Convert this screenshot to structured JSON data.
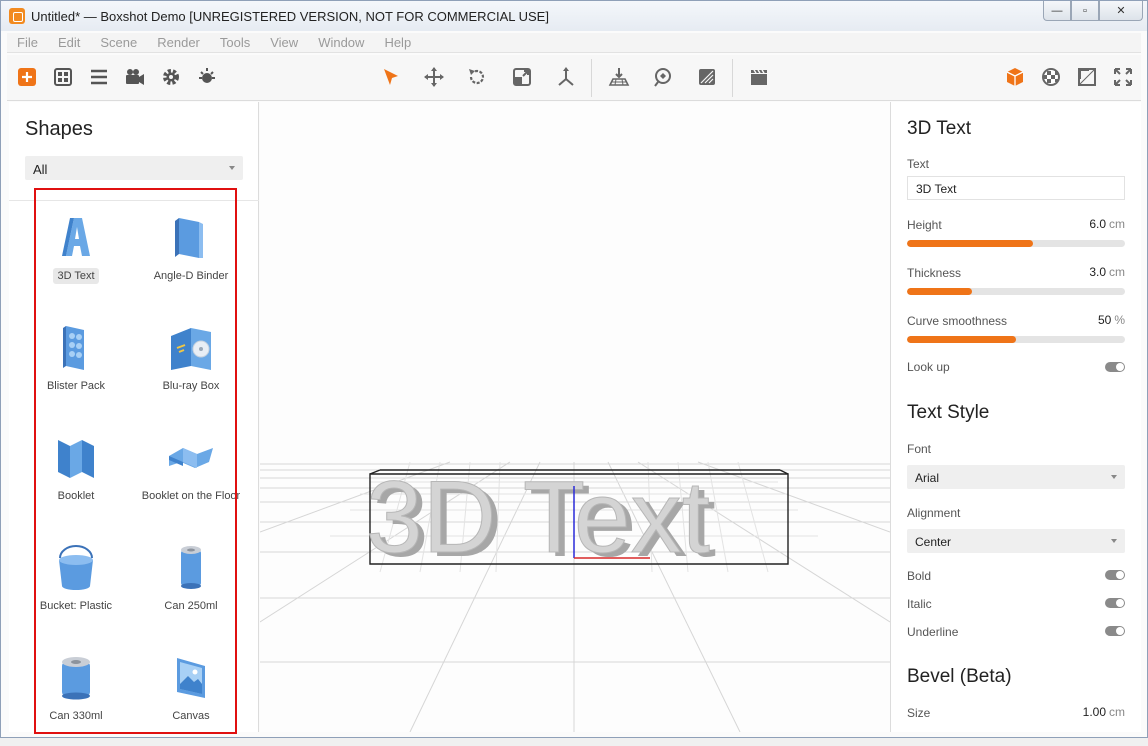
{
  "window": {
    "title": "Untitled* — Boxshot Demo [UNREGISTERED VERSION, NOT FOR COMMERCIAL USE]",
    "minimize_glyph": "—",
    "maximize_glyph": "▫",
    "close_glyph": "✕"
  },
  "menu": [
    "File",
    "Edit",
    "Scene",
    "Render",
    "Tools",
    "View",
    "Window",
    "Help"
  ],
  "toolbar": {
    "left_icons": [
      "add-icon",
      "grid-icon",
      "list-icon",
      "camera-icon",
      "gear-icon",
      "light-icon"
    ],
    "center_icons": [
      "select-arrow-icon",
      "move-icon",
      "rotate-icon",
      "scale-icon",
      "axis-icon"
    ],
    "center2_icons": [
      "floor-icon",
      "view-icon",
      "material-icon"
    ],
    "render_icon": "clapper-icon",
    "right_icons": [
      "cube-icon",
      "texture-icon",
      "frame-icon",
      "fullscreen-icon"
    ],
    "accent": "#ef7418"
  },
  "shapes_panel": {
    "title": "Shapes",
    "filter": "All",
    "items": [
      {
        "label": "3D Text",
        "icon": "text-3d-icon"
      },
      {
        "label": "Angle-D Binder",
        "icon": "binder-icon"
      },
      {
        "label": "Blister Pack",
        "icon": "blister-icon"
      },
      {
        "label": "Blu-ray Box",
        "icon": "bluray-icon"
      },
      {
        "label": "Booklet",
        "icon": "booklet-icon"
      },
      {
        "label": "Booklet on the Floor",
        "icon": "booklet-floor-icon"
      },
      {
        "label": "Bucket: Plastic",
        "icon": "bucket-icon"
      },
      {
        "label": "Can 250ml",
        "icon": "can-icon"
      },
      {
        "label": "Can 330ml",
        "icon": "can-icon"
      },
      {
        "label": "Canvas",
        "icon": "canvas-icon"
      }
    ]
  },
  "viewport": {
    "scene_text": "3D Text"
  },
  "props": {
    "section1_title": "3D Text",
    "text_label": "Text",
    "text_value": "3D Text",
    "height_label": "Height",
    "height_value": "6.0",
    "height_unit": "cm",
    "height_fill": 0.58,
    "thickness_label": "Thickness",
    "thickness_value": "3.0",
    "thickness_unit": "cm",
    "thickness_fill": 0.3,
    "curve_label": "Curve smoothness",
    "curve_value": "50",
    "curve_unit": "%",
    "curve_fill": 0.5,
    "lookup_label": "Look up",
    "section2_title": "Text Style",
    "font_label": "Font",
    "font_value": "Arial",
    "align_label": "Alignment",
    "align_value": "Center",
    "bold_label": "Bold",
    "italic_label": "Italic",
    "underline_label": "Underline",
    "section3_title": "Bevel (Beta)",
    "size_label": "Size",
    "size_value": "1.00",
    "size_unit": "cm"
  }
}
